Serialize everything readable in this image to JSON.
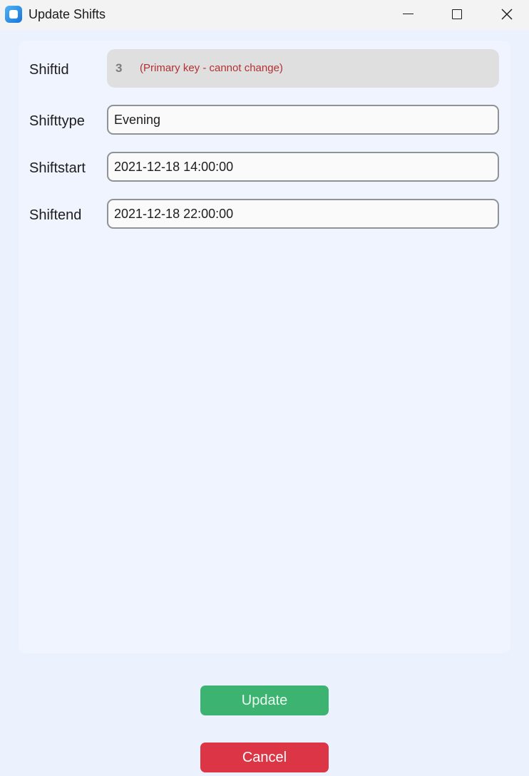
{
  "window": {
    "title": "Update Shifts",
    "icons": {
      "app": "app-icon",
      "minimize": "minimize-icon",
      "maximize": "maximize-icon",
      "close": "close-icon"
    }
  },
  "form": {
    "shiftid": {
      "label": "Shiftid",
      "value": "3",
      "note": "(Primary key - cannot change)"
    },
    "shifttype": {
      "label": "Shifttype",
      "value": "Evening"
    },
    "shiftstart": {
      "label": "Shiftstart",
      "value": "2021-12-18 14:00:00"
    },
    "shiftend": {
      "label": "Shiftend",
      "value": "2021-12-18 22:00:00"
    }
  },
  "actions": {
    "update_label": "Update",
    "cancel_label": "Cancel"
  },
  "colors": {
    "update": "#3cb371",
    "cancel": "#dc3545",
    "note": "#b33030",
    "background": "#ebf1fd"
  }
}
